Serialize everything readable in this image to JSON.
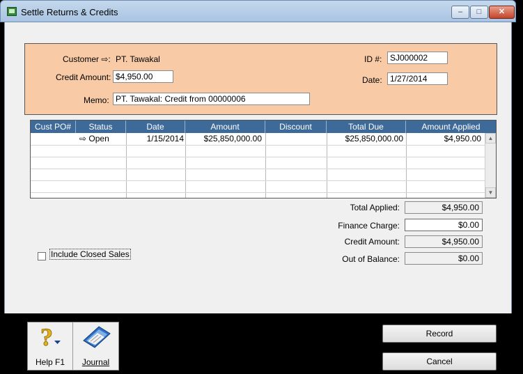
{
  "window": {
    "title": "Settle Returns & Credits"
  },
  "header": {
    "customer_label": "Customer",
    "customer_value": "PT. Tawakal",
    "credit_amount_label": "Credit Amount:",
    "credit_amount_value": "$4,950.00",
    "memo_label": "Memo:",
    "memo_value": "PT. Tawakal: Credit from 00000006",
    "id_label": "ID #:",
    "id_value": "SJ000002",
    "date_label": "Date:",
    "date_value": "1/27/2014"
  },
  "grid": {
    "columns": [
      "Cust PO#",
      "Status",
      "Date",
      "Amount",
      "Discount",
      "Total Due",
      "Amount Applied"
    ],
    "rows": [
      {
        "cust_po": "",
        "status": "Open",
        "date": "1/15/2014",
        "amount": "$25,850,000.00",
        "discount": "",
        "total_due": "$25,850,000.00",
        "amount_applied": "$4,950.00"
      }
    ]
  },
  "totals": {
    "total_applied_label": "Total Applied:",
    "total_applied_value": "$4,950.00",
    "finance_charge_label": "Finance Charge:",
    "finance_charge_value": "$0.00",
    "credit_amount_label": "Credit Amount:",
    "credit_amount_value": "$4,950.00",
    "out_of_balance_label": "Out of Balance:",
    "out_of_balance_value": "$0.00"
  },
  "include_closed_sales": {
    "label": "Include Closed Sales",
    "checked": false
  },
  "toolbar": {
    "help_label": "Help F1",
    "journal_label": "Journal"
  },
  "buttons": {
    "record_label": "Record",
    "cancel_label": "Cancel"
  },
  "colors": {
    "header_panel": "#f8cba6",
    "grid_header": "#3e6a9a",
    "window_frame": "#a9c4e2"
  }
}
